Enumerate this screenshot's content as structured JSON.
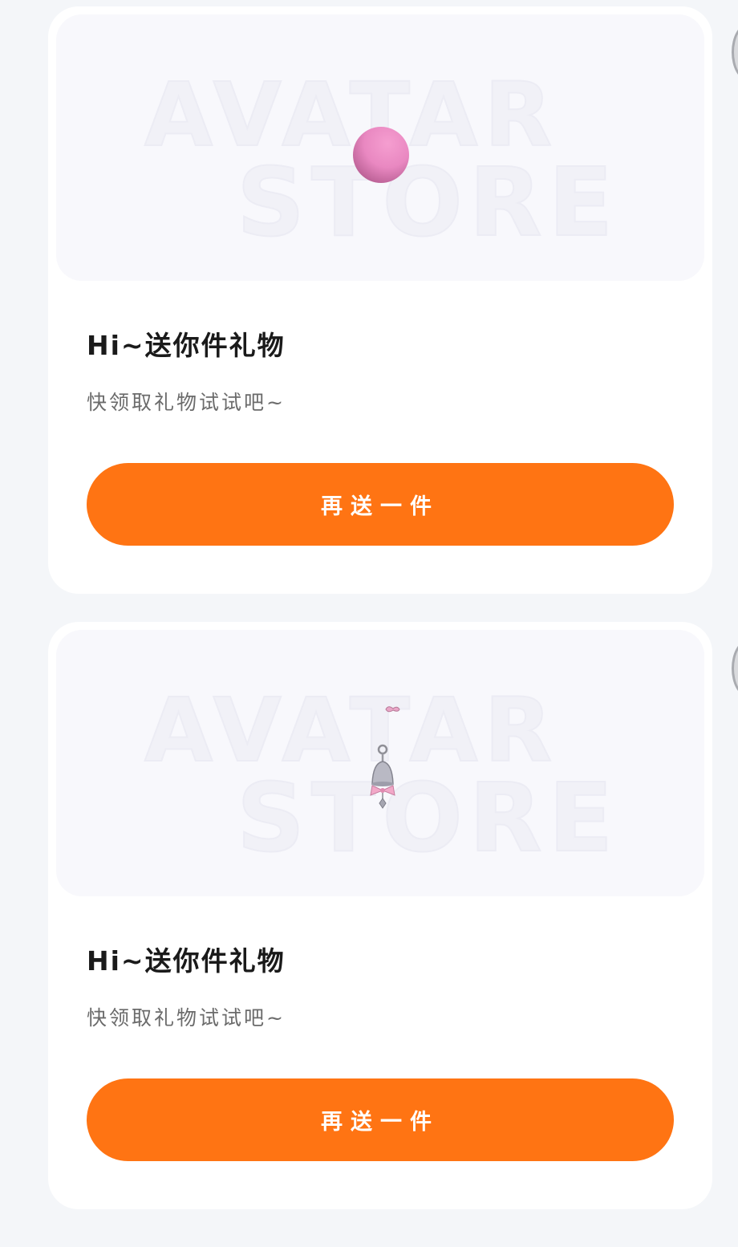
{
  "gift_cards": [
    {
      "watermark_line1": "AVATAR",
      "watermark_line2": "STORE",
      "item_icon": "pink-ball-icon",
      "title": "Hi~送你件礼物",
      "subtitle": "快领取礼物试试吧~",
      "button_label": "再送一件"
    },
    {
      "watermark_line1": "AVATAR",
      "watermark_line2": "STORE",
      "item_icon": "bell-charm-icon",
      "title": "Hi~送你件礼物",
      "subtitle": "快领取礼物试试吧~",
      "button_label": "再送一件"
    }
  ],
  "colors": {
    "page_background": "#f4f6f9",
    "card_background": "#ffffff",
    "preview_background": "#f8f8fc",
    "button": "#ff7413",
    "button_text": "#ffffff",
    "title_text": "#1a1a1a",
    "subtitle_text": "#6b6b6b"
  }
}
